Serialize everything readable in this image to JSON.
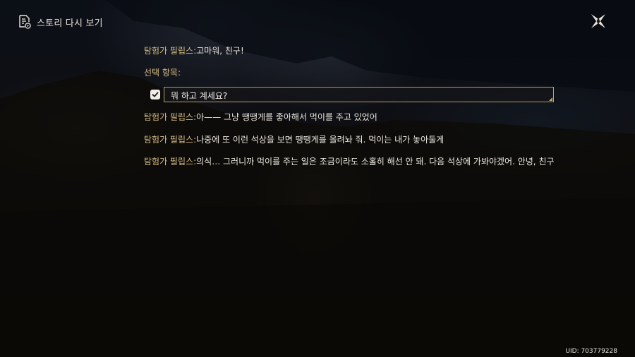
{
  "header": {
    "title": "스토리 다시 보기",
    "icon": "document-replay-icon"
  },
  "close": {
    "icon": "close-x-icon"
  },
  "dialog": {
    "lines_before": [
      {
        "speaker": "탐험가 필립스",
        "separator": ":",
        "text": "고마워, 친구!"
      }
    ],
    "options_label": "선택 항목:",
    "selected_option": {
      "checked": true,
      "text": "뭐 하고 계세요?"
    },
    "lines_after": [
      {
        "speaker": "탐험가 필립스",
        "separator": ":",
        "text": "아—— 그냥 땡땡게를 좋아해서 먹이를 주고 있었어"
      },
      {
        "speaker": "탐험가 필립스",
        "separator": ":",
        "text": "나중에 또 이런 석상을 보면 땡땡게를 올려놔 줘. 먹이는 내가 놓아둘게"
      },
      {
        "speaker": "탐험가 필립스",
        "separator": ":",
        "text": "의식… 그러니까 먹이를 주는 일은 조금이라도 소홀히 해선 안 돼. 다음 석상에 가봐야겠어. 안녕, 친구"
      }
    ]
  },
  "footer": {
    "uid": "UID: 703779228"
  },
  "colors": {
    "speaker": "#d7bd86",
    "text": "#ece8e0",
    "option_border": "#bda57a"
  }
}
